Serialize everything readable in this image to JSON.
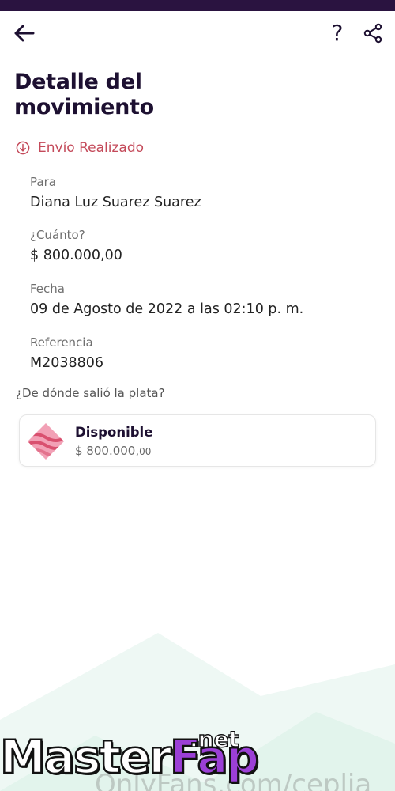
{
  "header": {
    "title": "Detalle del movimiento",
    "help_label": "?"
  },
  "status": {
    "text": "Envío Realizado",
    "color": "#c44a5a",
    "icon": "arrow-down-circle-icon"
  },
  "details": {
    "to": {
      "label": "Para",
      "value": "Diana Luz Suarez Suarez"
    },
    "amount": {
      "label": "¿Cuánto?",
      "value": "$ 800.000,00"
    },
    "date": {
      "label": "Fecha",
      "value": "09 de Agosto de 2022 a las 02:10 p. m."
    },
    "reference": {
      "label": "Referencia",
      "value": "M2038806"
    }
  },
  "source": {
    "question": "¿De dónde salió la plata?",
    "account": {
      "name": "Disponible",
      "amount_main": "$ 800.000,",
      "amount_cents": "00",
      "icon": "pocket-icon"
    }
  },
  "watermark": {
    "brand_part1": "Master",
    "brand_part2": "Fap",
    "brand_suffix": ".net",
    "faint_text": "OnlyFans.com/ceplia"
  },
  "colors": {
    "brand_dark": "#1d1031",
    "status_bar": "#2a1340",
    "accent_red": "#c44a5a"
  }
}
